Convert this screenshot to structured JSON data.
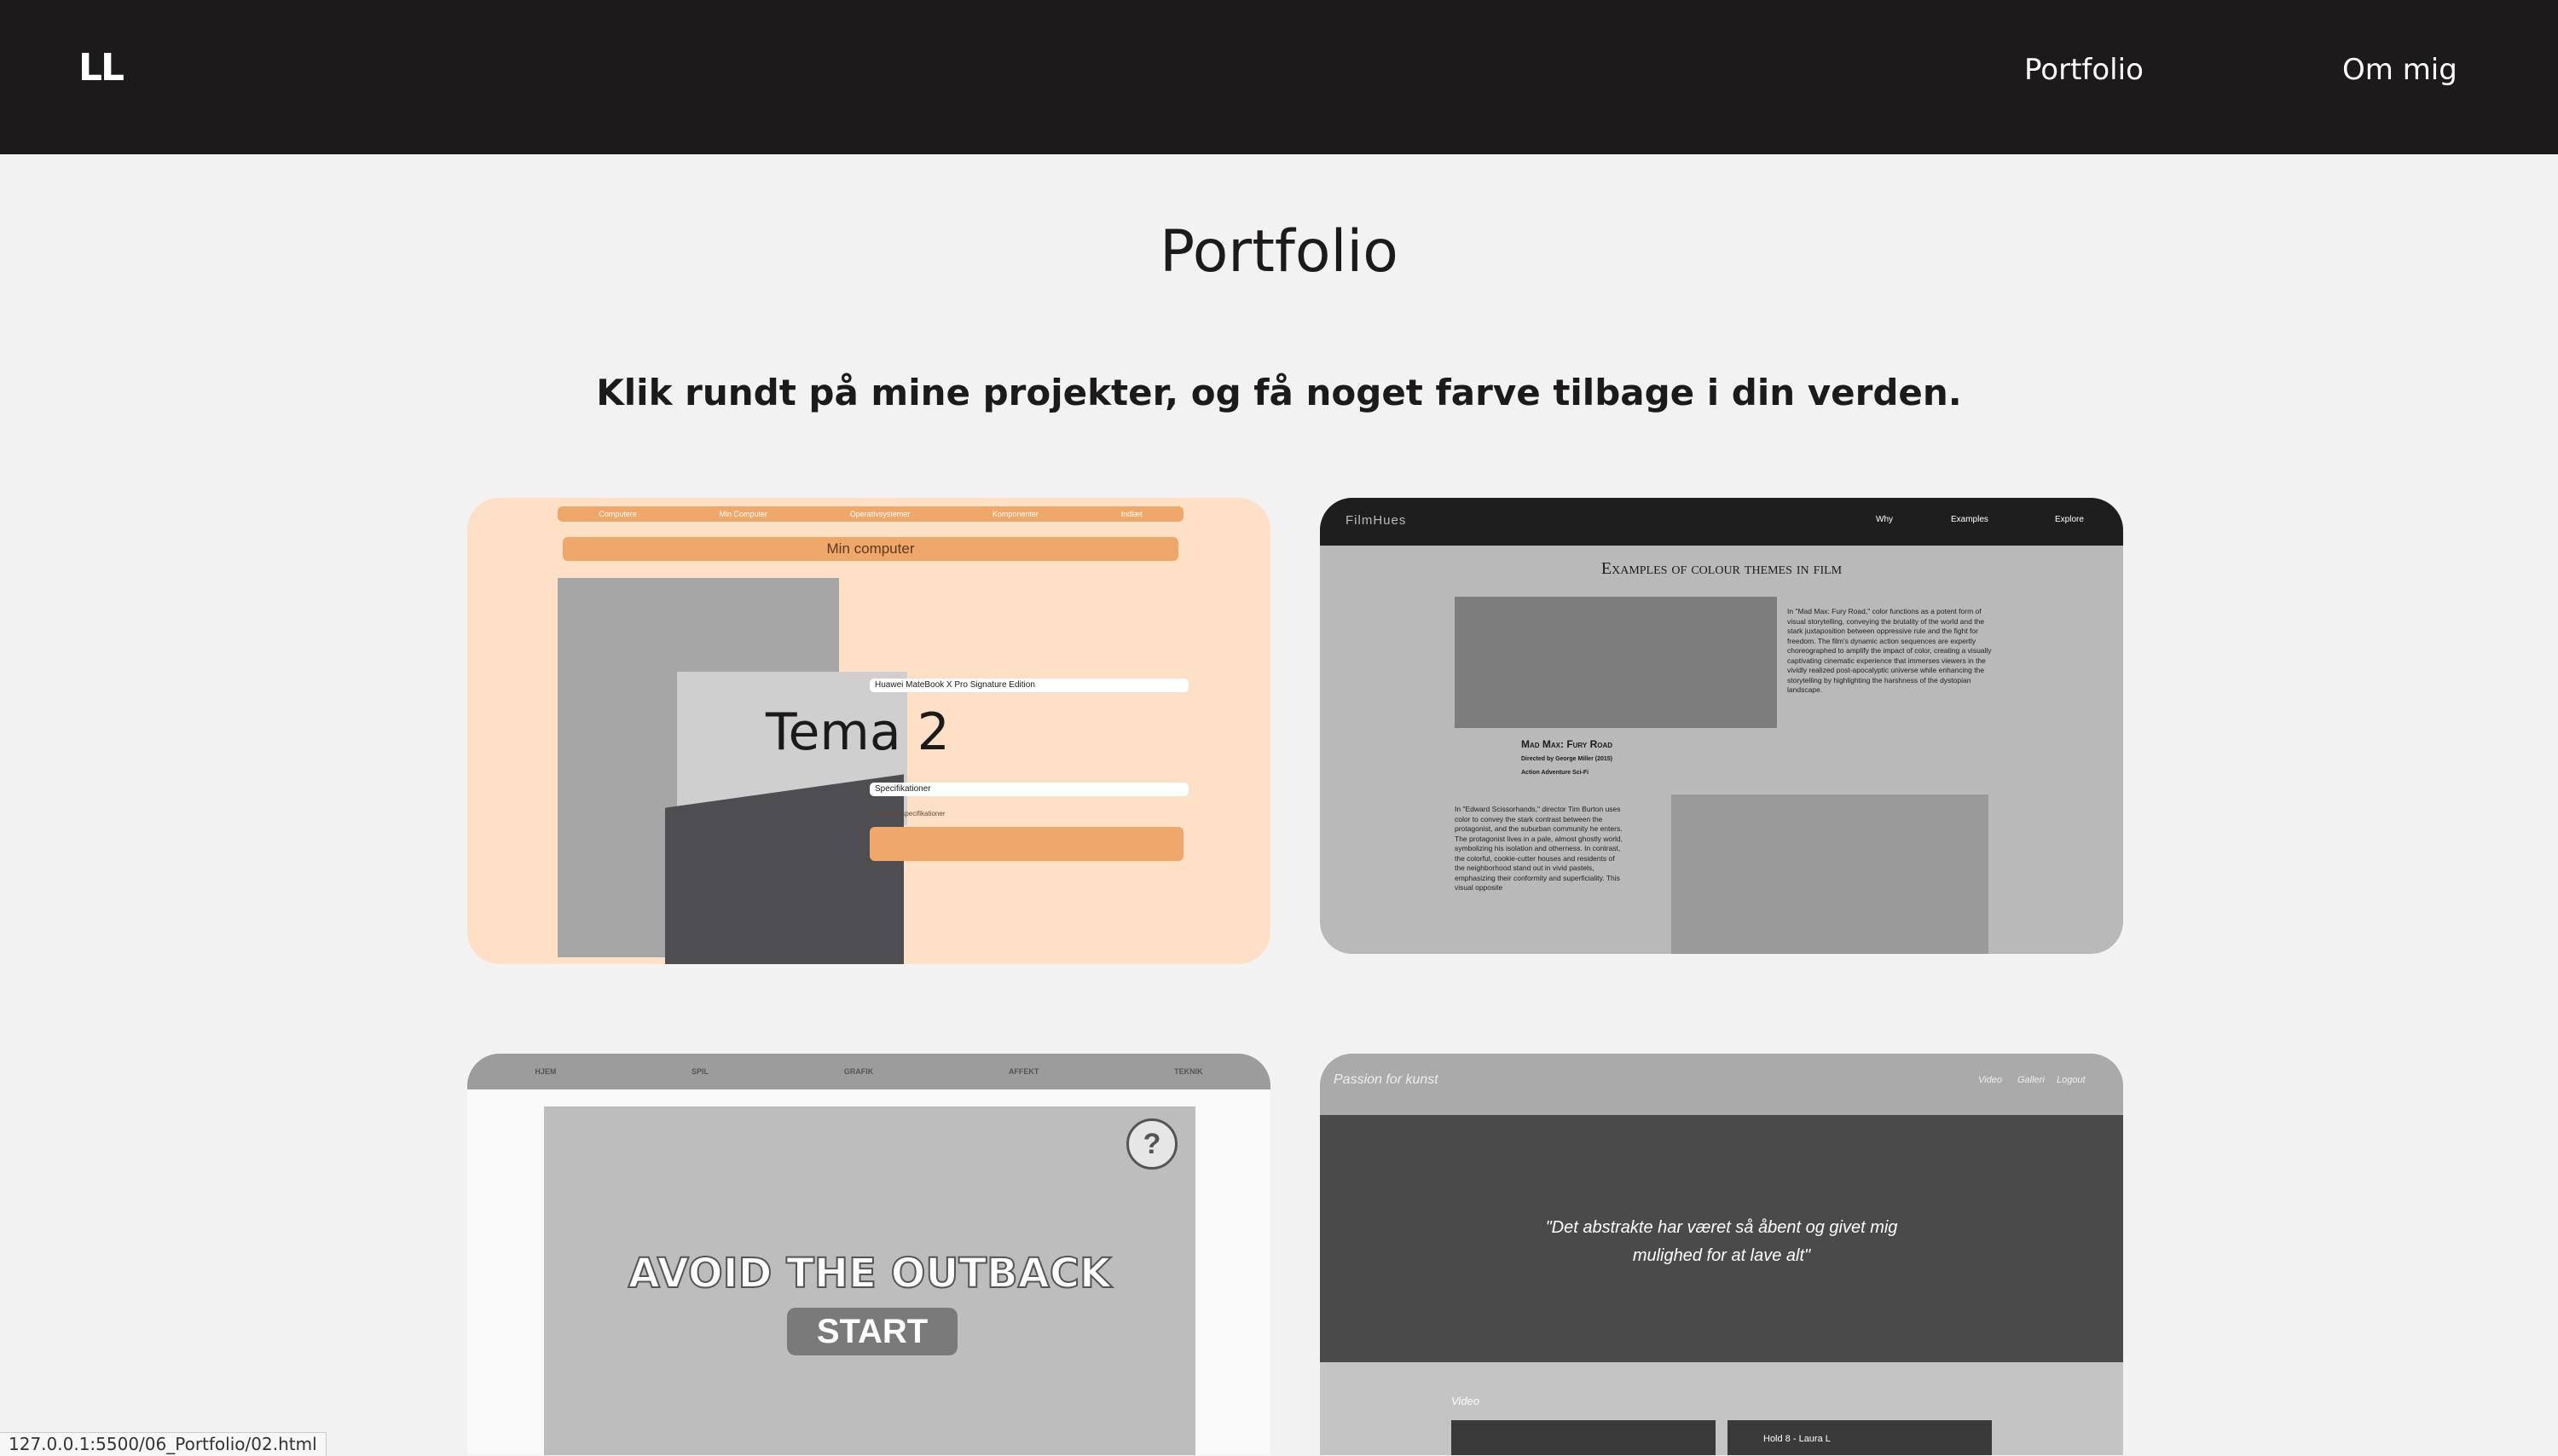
{
  "nav": {
    "logo": "LL",
    "links": [
      "Portfolio",
      "Om mig"
    ]
  },
  "page": {
    "title": "Portfolio",
    "tagline": "Klik rundt på mine projekter, og få noget farve tilbage i din verden."
  },
  "cards": [
    {
      "label": "Tema 2",
      "preview": {
        "nav": [
          "Computere",
          "Min Computer",
          "Operativsystemer",
          "Komponenter",
          "Indlæt"
        ],
        "bar": "Min computer",
        "heading": "Huawei MateBook X Pro Signature Edition",
        "subheading": "Specifikationer",
        "spec_label": "Computer specifikationer"
      }
    },
    {
      "preview": {
        "brand": "FilmHues",
        "nav": [
          "Why",
          "Examples",
          "Explore"
        ],
        "heading": "Examples of colour themes in film",
        "film_title": "Mad Max: Fury Road",
        "director": "Directed by George Miller (2015)",
        "genre": "Action Adventure Sci-Fi",
        "text1": "In \"Mad Max: Fury Road,\" color functions as a potent form of visual storytelling, conveying the brutality of the world and the stark juxtaposition between oppressive rule and the fight for freedom. The film's dynamic action sequences are expertly choreographed to amplify the impact of color, creating a visually captivating cinematic experience that immerses viewers in the vividly realized post-apocalyptic universe while enhancing the storytelling by highlighting the harshness of the dystopian landscape.",
        "text2": "In \"Edward Scissorhands,\" director Tim Burton uses color to convey the stark contrast between the protagonist, and the suburban community he enters. The protagonist lives in a pale, almost ghostly world, symbolizing his isolation and otherness. In contrast, the colorful, cookie-cutter houses and residents of the neighborhood stand out in vivid pastels, emphasizing their conformity and superficiality. This visual opposite"
      }
    },
    {
      "preview": {
        "nav": [
          "HJEM",
          "SPIL",
          "GRAFIK",
          "AFFEKT",
          "TEKNIK"
        ],
        "title": "AVOID THE OUTBACK",
        "start": "START",
        "help": "?"
      }
    },
    {
      "preview": {
        "brand": "Passion for kunst",
        "nav": [
          "Video",
          "Galleri",
          "Logout"
        ],
        "quote_line1": "\"Det abstrakte har været så åbent og givet mig",
        "quote_line2": "mulighed for at lave alt\"",
        "section": "Video",
        "thumb_title": "Hold 8 - Laura L"
      }
    }
  ],
  "status_bar": {
    "url": "127.0.0.1:5500/06_Portfolio/02.html"
  }
}
